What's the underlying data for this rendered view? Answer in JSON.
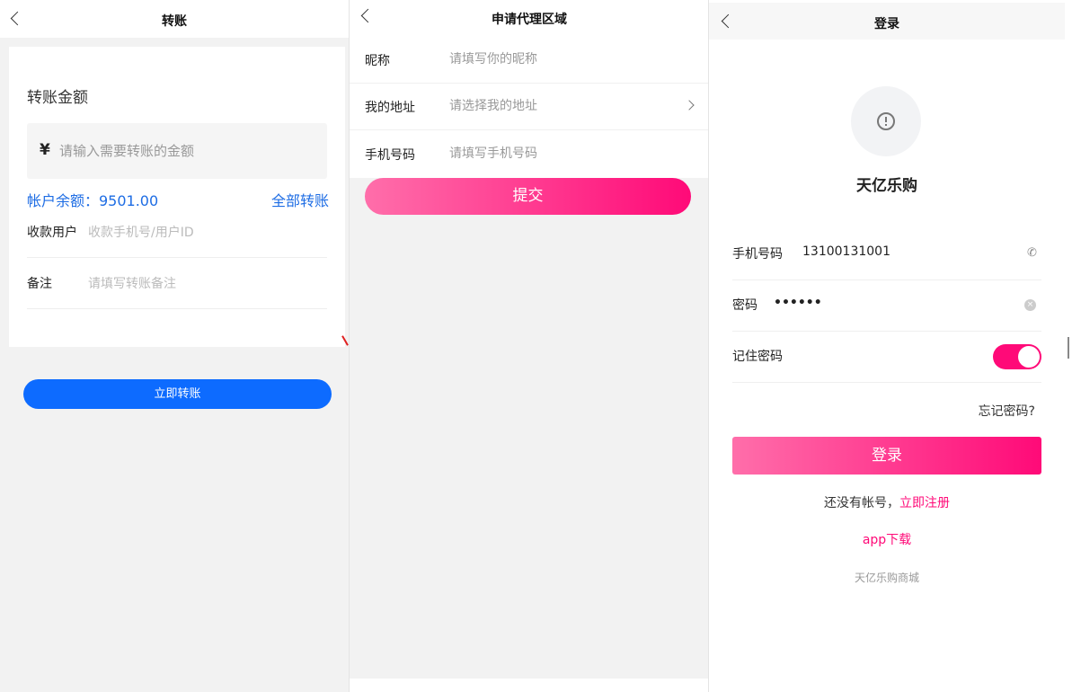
{
  "transfer": {
    "title": "转账",
    "amount_label": "转账金额",
    "currency_symbol": "¥",
    "amount_placeholder": "请输入需要转账的金额",
    "balance_text": "帐户余额：9501.00",
    "transfer_all": "全部转账",
    "recipient_label": "收款用户",
    "recipient_placeholder": "收款手机号/用户ID",
    "note_label": "备注",
    "note_placeholder": "请填写转账备注",
    "submit": "立即转账",
    "accent_color": "#0d6bff"
  },
  "agent": {
    "title": "申请代理区域",
    "nickname_label": "昵称",
    "nickname_placeholder": "请填写你的昵称",
    "address_label": "我的地址",
    "address_placeholder": "请选择我的地址",
    "phone_label": "手机号码",
    "phone_placeholder": "请填写手机号码",
    "submit": "提交"
  },
  "login": {
    "title": "登录",
    "app_name": "天亿乐购",
    "phone_label": "手机号码",
    "phone_value": "13100131001",
    "password_label": "密码",
    "password_value": "••••••",
    "remember_label": "记住密码",
    "remember_on": true,
    "forgot": "忘记密码?",
    "submit": "登录",
    "no_account": "还没有帐号，",
    "register": "立即注册",
    "app_download": "app下载",
    "footer": "天亿乐购商城",
    "accent_color": "#ff0a78"
  }
}
